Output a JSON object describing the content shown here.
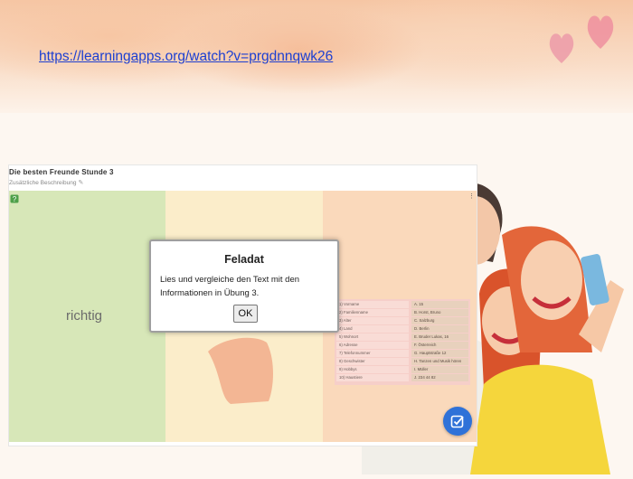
{
  "slide": {
    "link_text": "https://learningapps.org/watch?v=prgdnnqwk26"
  },
  "app": {
    "title": "Die besten Freunde Stunde 3",
    "subtitle": "Zusätzliche Beschreibung",
    "columns": [
      {
        "label": "richtig",
        "color": "#d7e7b8"
      },
      {
        "label": "",
        "color": "#fbedca"
      },
      {
        "label": "",
        "color": "#fad9bb"
      }
    ],
    "match_rows": [
      {
        "left": "1) Vorname",
        "right": "A. 15"
      },
      {
        "left": "2) Familienname",
        "right": "B. Horst, Bruno"
      },
      {
        "left": "3) Alter",
        "right": "C. Salzburg"
      },
      {
        "left": "4) Land",
        "right": "D. Berlin"
      },
      {
        "left": "5) Wohnort",
        "right": "E. Bruder Lukas, 16"
      },
      {
        "left": "6) Adresse",
        "right": "F. Österreich"
      },
      {
        "left": "7) Telefonnummer",
        "right": "G. Hauptstraße 12"
      },
      {
        "left": "8) Geschwister",
        "right": "H. Tanzen und Musik hören"
      },
      {
        "left": "9) Hobbys",
        "right": "I. Müller"
      },
      {
        "left": "10) Haustiere",
        "right": "J. 234 44 82"
      }
    ],
    "dialog": {
      "title": "Feladat",
      "text": "Lies und vergleiche den Text mit den Informationen in Übung 3.",
      "ok_label": "OK"
    }
  }
}
